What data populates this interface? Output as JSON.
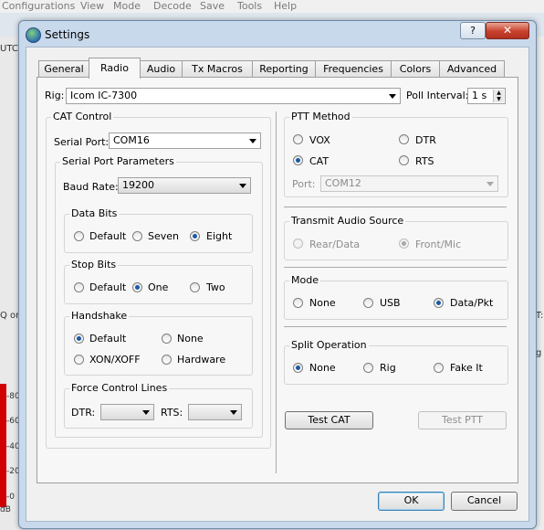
{
  "background": {
    "menu": [
      "Configurations",
      "View",
      "Mode",
      "Decode",
      "Save",
      "Tools",
      "Help"
    ],
    "left_labels": [
      "UTC",
      "Q on",
      "-80",
      "-60",
      "-40",
      "-20",
      "-0",
      "dB"
    ],
    "right_labels": [
      "T:",
      "g"
    ]
  },
  "dialog": {
    "title": "Settings",
    "help_label": "?",
    "close_label": "✕"
  },
  "tabs": [
    "General",
    "Radio",
    "Audio",
    "Tx Macros",
    "Reporting",
    "Frequencies",
    "Colors",
    "Advanced"
  ],
  "rig": {
    "label": "Rig:",
    "value": "Icom IC-7300"
  },
  "poll": {
    "label": "Poll Interval:",
    "value": "1 s"
  },
  "cat": {
    "title": "CAT Control",
    "serial_port_label": "Serial Port:",
    "serial_port_value": "COM16",
    "params_title": "Serial Port Parameters",
    "baud_label": "Baud Rate:",
    "baud_value": "19200",
    "data_bits": {
      "title": "Data Bits",
      "options": [
        "Default",
        "Seven",
        "Eight"
      ],
      "selected": 2
    },
    "stop_bits": {
      "title": "Stop Bits",
      "options": [
        "Default",
        "One",
        "Two"
      ],
      "selected": 1
    },
    "handshake": {
      "title": "Handshake",
      "options": [
        "Default",
        "None",
        "XON/XOFF",
        "Hardware"
      ],
      "selected": 0
    },
    "force": {
      "title": "Force Control Lines",
      "dtr_label": "DTR:",
      "rts_label": "RTS:",
      "dtr_value": "",
      "rts_value": ""
    }
  },
  "ptt": {
    "title": "PTT Method",
    "options": [
      "VOX",
      "DTR",
      "CAT",
      "RTS"
    ],
    "selected": "CAT",
    "port_label": "Port:",
    "port_value": "COM12"
  },
  "tx_audio": {
    "title": "Transmit Audio Source",
    "options": [
      "Rear/Data",
      "Front/Mic"
    ],
    "selected": "Front/Mic"
  },
  "mode": {
    "title": "Mode",
    "options": [
      "None",
      "USB",
      "Data/Pkt"
    ],
    "selected": "Data/Pkt"
  },
  "split": {
    "title": "Split Operation",
    "options": [
      "None",
      "Rig",
      "Fake It"
    ],
    "selected": "None"
  },
  "buttons": {
    "test_cat": "Test CAT",
    "test_ptt": "Test PTT",
    "ok": "OK",
    "cancel": "Cancel"
  },
  "colors": {
    "accent": "#1a5aa6",
    "close": "#c7412e",
    "meter": "#d00000"
  }
}
